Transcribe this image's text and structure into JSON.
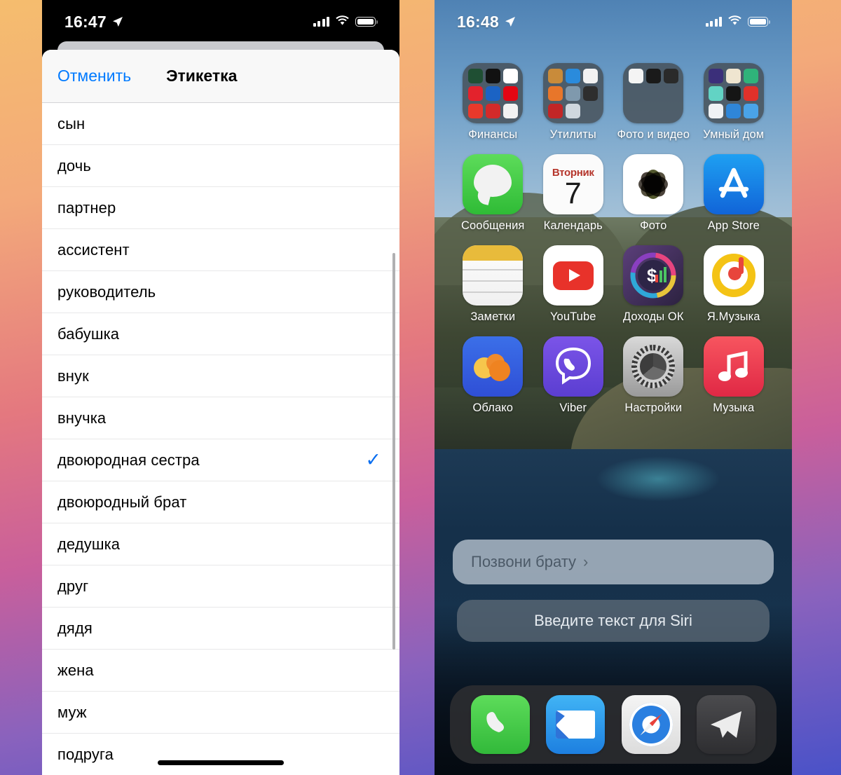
{
  "left_phone": {
    "status_bar": {
      "time": "16:47",
      "location_icon": "location-arrow-icon",
      "signal_icon": "cellular-bars-icon",
      "wifi_icon": "wifi-icon",
      "battery_icon": "battery-icon"
    },
    "sheet": {
      "cancel_label": "Отменить",
      "title": "Этикетка",
      "selected_value": "двоюродная сестра",
      "check_glyph": "✓",
      "items": [
        {
          "label": "сын",
          "selected": false
        },
        {
          "label": "дочь",
          "selected": false
        },
        {
          "label": "партнер",
          "selected": false
        },
        {
          "label": "ассистент",
          "selected": false
        },
        {
          "label": "руководитель",
          "selected": false
        },
        {
          "label": "бабушка",
          "selected": false
        },
        {
          "label": "внук",
          "selected": false
        },
        {
          "label": "внучка",
          "selected": false
        },
        {
          "label": "двоюродная сестра",
          "selected": true
        },
        {
          "label": "двоюродный брат",
          "selected": false
        },
        {
          "label": "дедушка",
          "selected": false
        },
        {
          "label": "друг",
          "selected": false
        },
        {
          "label": "дядя",
          "selected": false
        },
        {
          "label": "жена",
          "selected": false
        },
        {
          "label": "муж",
          "selected": false
        },
        {
          "label": "подруга",
          "selected": false
        }
      ]
    },
    "accent_color": "#007aff"
  },
  "right_phone": {
    "status_bar": {
      "time": "16:48",
      "location_icon": "location-arrow-icon",
      "signal_icon": "cellular-bars-icon",
      "wifi_icon": "wifi-icon",
      "battery_icon": "battery-icon"
    },
    "home_screen": {
      "rows": [
        [
          {
            "label": "Финансы",
            "kind": "folder",
            "icon": "folder-icon"
          },
          {
            "label": "Утилиты",
            "kind": "folder",
            "icon": "folder-icon"
          },
          {
            "label": "Фото и видео",
            "kind": "folder",
            "icon": "folder-icon"
          },
          {
            "label": "Умный дом",
            "kind": "folder",
            "icon": "folder-icon"
          }
        ],
        [
          {
            "label": "Сообщения",
            "kind": "app",
            "icon": "messages-icon"
          },
          {
            "label": "Календарь",
            "kind": "app",
            "icon": "calendar-icon",
            "day_name": "Вторник",
            "day_number": "7"
          },
          {
            "label": "Фото",
            "kind": "app",
            "icon": "photos-icon"
          },
          {
            "label": "App Store",
            "kind": "app",
            "icon": "appstore-icon"
          }
        ],
        [
          {
            "label": "Заметки",
            "kind": "app",
            "icon": "notes-icon"
          },
          {
            "label": "YouTube",
            "kind": "app",
            "icon": "youtube-icon"
          },
          {
            "label": "Доходы ОК",
            "kind": "app",
            "icon": "dohody-ok-icon"
          },
          {
            "label": "Я.Музыка",
            "kind": "app",
            "icon": "yandex-music-icon"
          }
        ],
        [
          {
            "label": "Облако",
            "kind": "app",
            "icon": "cloud-mail-icon"
          },
          {
            "label": "Viber",
            "kind": "app",
            "icon": "viber-icon"
          },
          {
            "label": "Настройки",
            "kind": "app",
            "icon": "settings-gear-icon"
          },
          {
            "label": "Музыка",
            "kind": "app",
            "icon": "music-note-icon"
          }
        ]
      ]
    },
    "siri": {
      "query_text": "Позвони брату",
      "query_chevron": "›",
      "input_placeholder": "Введите текст для Siri"
    },
    "dock": [
      {
        "label": "Телефон",
        "icon": "phone-icon"
      },
      {
        "label": "Почта",
        "icon": "mail-icon"
      },
      {
        "label": "Safari",
        "icon": "safari-compass-icon"
      },
      {
        "label": "Telegram",
        "icon": "telegram-plane-icon"
      }
    ]
  },
  "background": {
    "gradient_start": "#f5bd6e",
    "gradient_mid": "#c95f9b",
    "gradient_end": "#4a52c8"
  }
}
